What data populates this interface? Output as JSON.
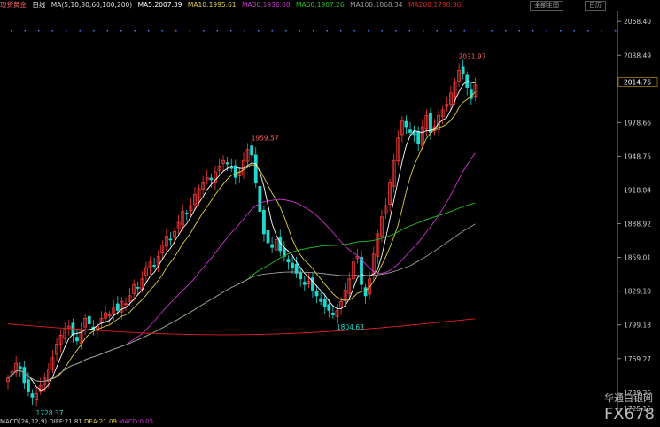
{
  "header": {
    "symbol": "现货黄金",
    "period": "日线",
    "ma_label": "MA(5,10,30,60,100,200)",
    "ma5": "MA5:2007.39",
    "ma10": "MA10:1995.61",
    "ma30": "MA30:1936.08",
    "ma60": "MA60:1907.26",
    "ma100": "MA100:1868.34",
    "ma200": "MA200:1790.36",
    "main_btn": "全部主图",
    "daily_btn": "日历"
  },
  "colors": {
    "up": "#ff3b3b",
    "down": "#1fd8d0",
    "ma5": "#ffffff",
    "ma10": "#e0d040",
    "ma30": "#cc33cc",
    "ma60": "#22c022",
    "ma100": "#9a9a9a",
    "ma200": "#e02020"
  },
  "yaxis": [
    "2068.40",
    "2038.49",
    "2014.76",
    "1978.66",
    "1948.75",
    "1918.84",
    "1888.92",
    "1859.01",
    "1829.10",
    "1799.18",
    "1769.27",
    "1739.36",
    "1725.15"
  ],
  "current_price": "2014.76",
  "annotations": {
    "high1": "1959.57",
    "low1": "1728.37",
    "low2": "1804.63",
    "high2": "2031.97"
  },
  "footer": {
    "macd": "MACD(26,12,9)",
    "diff": "DIFF:21.81",
    "dea": "DEA:21.09",
    "macd_val": "MACD:0.05"
  },
  "watermark": "FX678",
  "watermark_cn": "华通白银网"
}
